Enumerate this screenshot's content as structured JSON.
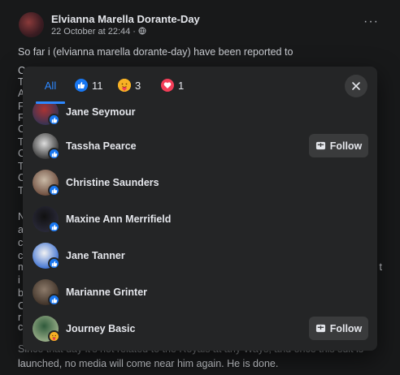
{
  "post": {
    "author": "Elvianna Marella Dorante-Day",
    "meta": "22 October at 22:44 · ",
    "menu": "···",
    "line1": "So far i (elvianna marella dorante-day) have been reported to",
    "edge_left": [
      "C",
      "T",
      "A",
      "F",
      "F",
      "C",
      "T",
      "C",
      "T",
      "C",
      "T",
      "N",
      "a",
      "c",
      "c",
      "m",
      "i",
      "b",
      "C",
      "r",
      "c"
    ],
    "edge_right": "t",
    "bottom_line1": "Since that day it's not related to the Royals at any Ways, and once this suit is",
    "bottom_line2": "launched, no media will come near him again. He is done."
  },
  "modal": {
    "tabs": {
      "all": "All",
      "like_count": "11",
      "care_count": "3",
      "love_count": "1"
    },
    "rows": [
      {
        "name": "Jane Seymour",
        "reaction": "like",
        "follow": false,
        "avatar": [
          "#a33",
          "#335"
        ]
      },
      {
        "name": "Tassha Pearce",
        "reaction": "like",
        "follow": true,
        "avatar": [
          "#ddd",
          "#333"
        ]
      },
      {
        "name": "Christine Saunders",
        "reaction": "like",
        "follow": false,
        "avatar": [
          "#c9b9a6",
          "#6b4a3b"
        ]
      },
      {
        "name": "Maxine Ann Merrifield",
        "reaction": "like",
        "follow": false,
        "avatar": [
          "#111",
          "#2a2a3a"
        ]
      },
      {
        "name": "Jane Tanner",
        "reaction": "like",
        "follow": false,
        "avatar": [
          "#f2f2f2",
          "#3b6fd1"
        ]
      },
      {
        "name": "Marianne Grinter",
        "reaction": "like",
        "follow": false,
        "avatar": [
          "#8c7a6a",
          "#3d3026"
        ]
      },
      {
        "name": "Journey Basic",
        "reaction": "care",
        "follow": true,
        "avatar": [
          "#2f5a3b",
          "#9bb08a"
        ]
      }
    ],
    "follow_label": "Follow"
  },
  "colors": {
    "accent": "#2d88ff",
    "like": "#1877f2",
    "care": "#f7b125",
    "love": "#f33e58"
  }
}
